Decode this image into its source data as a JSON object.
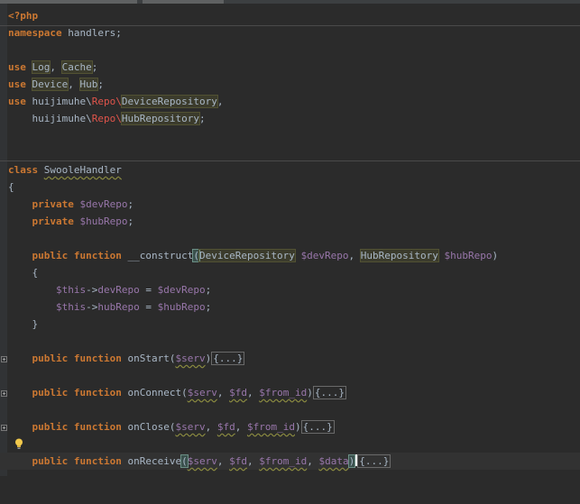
{
  "code": {
    "open_tag": "<?php",
    "namespace_kw": "namespace",
    "namespace_name": "handlers;",
    "use_kw": "use",
    "use1_a": "Log",
    "use1_sep": ", ",
    "use1_b": "Cache",
    "use1_end": ";",
    "use2_a": "Device",
    "use2_sep": ", ",
    "use2_b": "Hub",
    "use2_end": ";",
    "use3_ns": "huijimuhe\\",
    "use3_repo": "Repo",
    "use3_bs": "\\",
    "use3_cls": "DeviceRepository",
    "use3_end": ",",
    "use4_ns": "huijimuhe\\",
    "use4_repo": "Repo",
    "use4_bs": "\\",
    "use4_cls": "HubRepository",
    "use4_end": ";",
    "class_kw": "class",
    "class_name": "SwooleHandler",
    "brace_open": "{",
    "brace_close": "}",
    "private_kw": "private",
    "prop1": "$devRepo",
    "prop2": "$hubRepo",
    "semi": ";",
    "public_kw": "public",
    "function_kw": "function",
    "ctor_name": "__construct",
    "ctor_type1": "DeviceRepository",
    "ctor_arg1": "$devRepo",
    "ctor_type2": "HubRepository",
    "ctor_arg2": "$hubRepo",
    "this": "$this",
    "arrow": "->",
    "assign_prop1": "devRepo",
    "assign_prop2": "hubRepo",
    "eq": " = ",
    "m1_name": "onStart",
    "m1_args": "$serv",
    "m2_name": "onConnect",
    "m2_a1": "$serv",
    "m2_a2": "$fd",
    "m2_a3": "$from_id",
    "m3_name": "onClose",
    "m3_a1": "$serv",
    "m3_a2": "$fd",
    "m3_a3": "$from_id",
    "m4_name": "onReceive",
    "m4_a1": "$serv",
    "m4_a2": "$fd",
    "m4_a3": "$from_id",
    "m4_a4": "$data",
    "folded": "{...}",
    "comma": ", "
  },
  "colors": {
    "background": "#2b2b2b",
    "keyword": "#cc7832",
    "variable": "#9876aa",
    "text": "#a9b7c6",
    "namespace_highlight": "#e0544b"
  },
  "icons": {
    "intention": "lightbulb-icon",
    "fold": "fold-toggle-icon"
  }
}
